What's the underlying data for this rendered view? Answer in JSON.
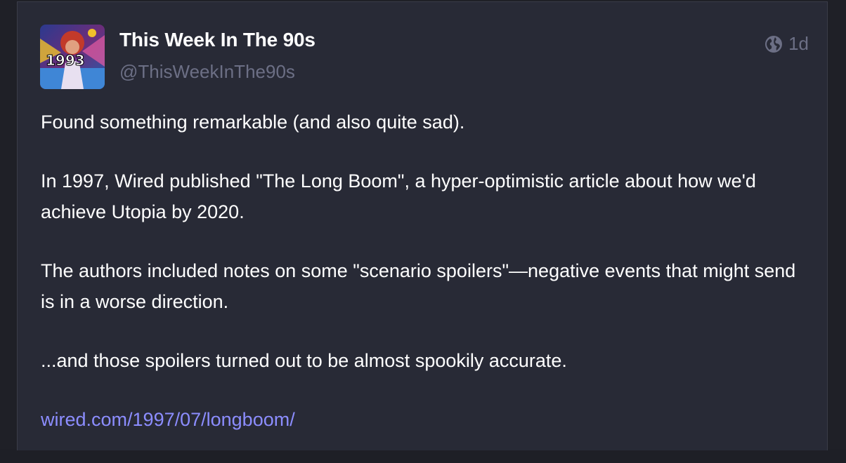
{
  "post": {
    "display_name": "This Week In The 90s",
    "handle": "@ThisWeekInThe90s",
    "avatar_text": "1993",
    "timestamp": "1d",
    "visibility_icon": "globe-icon",
    "paragraphs": [
      "Found something remarkable (and also quite sad).",
      "In 1997, Wired published \"The Long Boom\", a hyper-optimistic article about how we'd achieve Utopia by 2020.",
      "The authors included notes on some \"scenario spoilers\"—negative events that might send is in a worse direction.",
      "...and those spoilers turned out to be almost spookily accurate."
    ],
    "link_text": "wired.com/1997/07/longboom/"
  },
  "colors": {
    "background": "#282a36",
    "text": "#ffffff",
    "muted": "#6c6f85",
    "link": "#8c8dff"
  }
}
